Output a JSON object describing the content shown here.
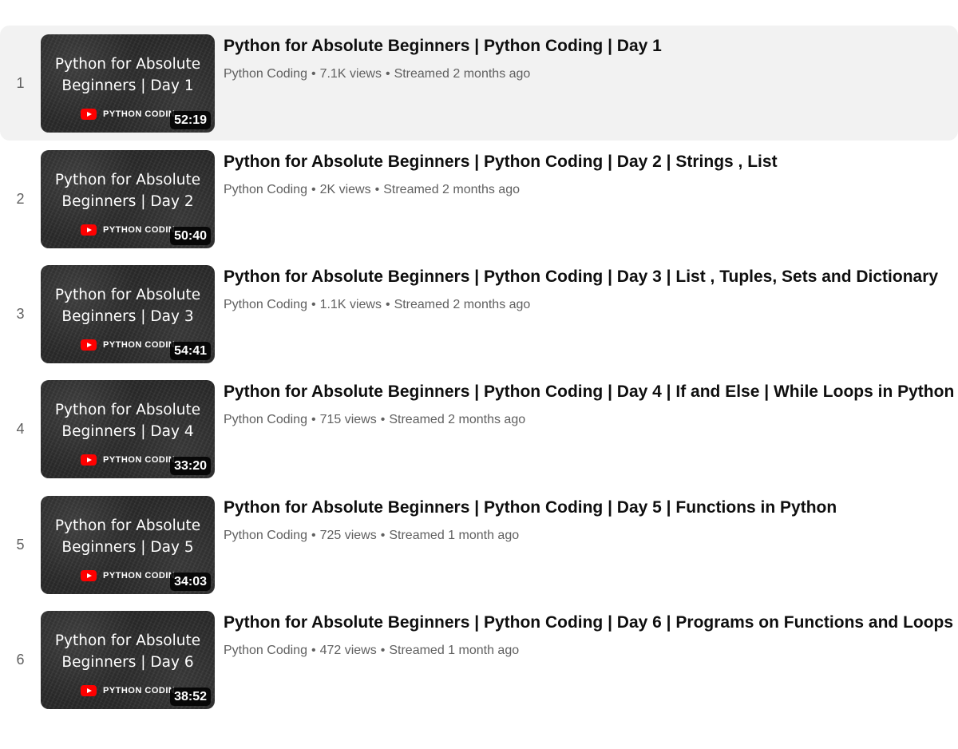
{
  "playlist": {
    "items": [
      {
        "index": "1",
        "thumb_line1": "Python for Absolute",
        "thumb_line2": "Beginners | Day 1",
        "brand": "PYTHON CODIN",
        "duration": "52:19",
        "title": "Python for Absolute Beginners | Python Coding | Day 1",
        "channel": "Python Coding",
        "views": "7.1K views",
        "streamed": "Streamed 2 months ago",
        "active": true
      },
      {
        "index": "2",
        "thumb_line1": "Python for Absolute",
        "thumb_line2": "Beginners | Day 2",
        "brand": "PYTHON CODIN",
        "duration": "50:40",
        "title": "Python for Absolute Beginners | Python Coding | Day 2 | Strings , List",
        "channel": "Python Coding",
        "views": "2K views",
        "streamed": "Streamed 2 months ago",
        "active": false
      },
      {
        "index": "3",
        "thumb_line1": "Python for Absolute",
        "thumb_line2": "Beginners | Day 3",
        "brand": "PYTHON CODIN",
        "duration": "54:41",
        "title": "Python for Absolute Beginners | Python Coding | Day 3 | List , Tuples, Sets and Dictionary",
        "channel": "Python Coding",
        "views": "1.1K views",
        "streamed": "Streamed 2 months ago",
        "active": false
      },
      {
        "index": "4",
        "thumb_line1": "Python for Absolute",
        "thumb_line2": "Beginners | Day 4",
        "brand": "PYTHON CODIN",
        "duration": "33:20",
        "title": "Python for Absolute Beginners | Python Coding | Day 4 | If and Else | While Loops in Python",
        "channel": "Python Coding",
        "views": "715 views",
        "streamed": "Streamed 2 months ago",
        "active": false
      },
      {
        "index": "5",
        "thumb_line1": "Python for Absolute",
        "thumb_line2": "Beginners | Day 5",
        "brand": "PYTHON CODIN",
        "duration": "34:03",
        "title": "Python for Absolute Beginners | Python Coding | Day 5 | Functions in Python",
        "channel": "Python Coding",
        "views": "725 views",
        "streamed": "Streamed 1 month ago",
        "active": false
      },
      {
        "index": "6",
        "thumb_line1": "Python for Absolute",
        "thumb_line2": "Beginners | Day 6",
        "brand": "PYTHON CODIN",
        "duration": "38:52",
        "title": "Python for Absolute Beginners | Python Coding | Day 6 | Programs on Functions and Loops",
        "channel": "Python Coding",
        "views": "472 views",
        "streamed": "Streamed 1 month ago",
        "active": false
      }
    ],
    "meta_separator": "•"
  },
  "colors": {
    "active_row_bg": "#f2f2f2",
    "title_text": "#0f0f0f",
    "meta_text": "#606060",
    "brand_red": "#ff0000"
  },
  "icons": {
    "brand_logo": "youtube-logo-icon"
  }
}
